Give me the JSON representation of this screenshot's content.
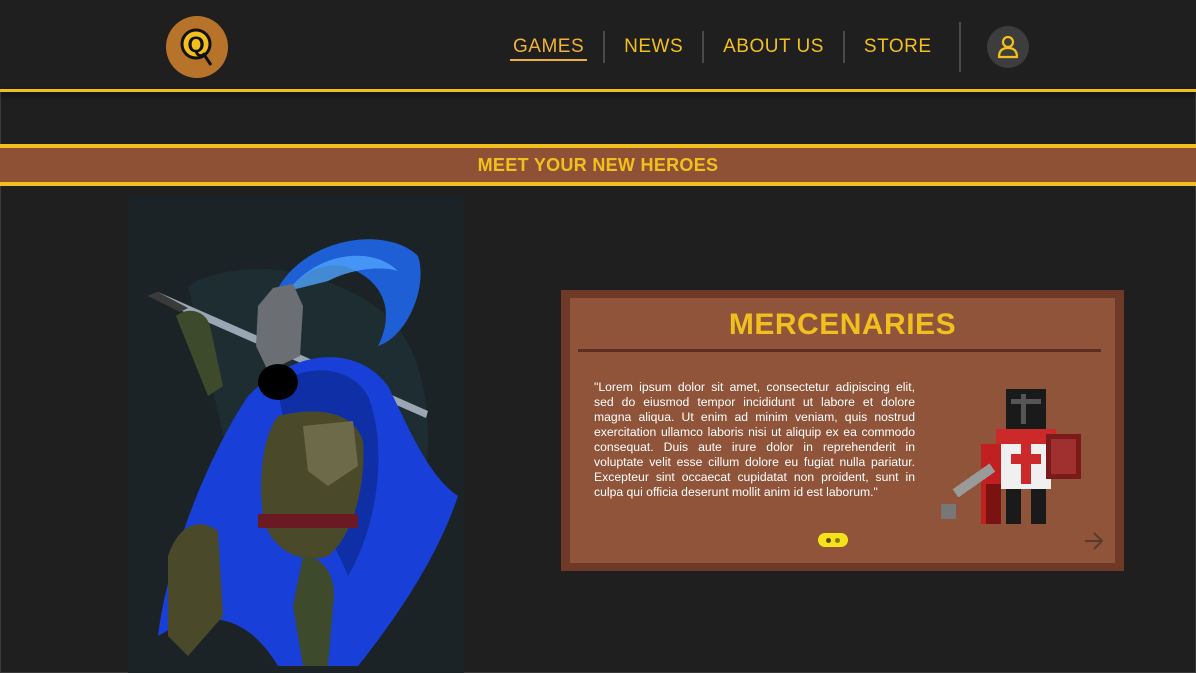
{
  "nav": {
    "logo_letter": "Q",
    "items": [
      {
        "label": "GAMES",
        "active": true
      },
      {
        "label": "NEWS",
        "active": false
      },
      {
        "label": "ABOUT US",
        "active": false
      },
      {
        "label": "STORE",
        "active": false
      }
    ],
    "profile_icon": "user-icon"
  },
  "banner": {
    "title": "MEET YOUR NEW HEROES"
  },
  "card": {
    "title": "MERCENARIES",
    "description": "\"Lorem ipsum dolor sit amet, consectetur adipiscing elit, sed do eiusmod tempor incididunt ut labore et dolore magna aliqua. Ut enim ad minim veniam, quis nostrud exercitation ullamco laboris nisi ut aliquip ex ea commodo consequat. Duis aute irure dolor in reprehenderit in voluptate velit esse cillum dolore eu fugiat nulla pariatur. Excepteur sint occaecat cupidatat non proident, sunt in culpa qui officia deserunt mollit anim id est laborum.\"",
    "next_icon": "arrow-right-icon"
  },
  "colors": {
    "accent": "#f2c01e",
    "background": "#1f1f1f",
    "banner": "#8f5136",
    "card": "#8f5439",
    "card_border": "#6e3a27"
  }
}
